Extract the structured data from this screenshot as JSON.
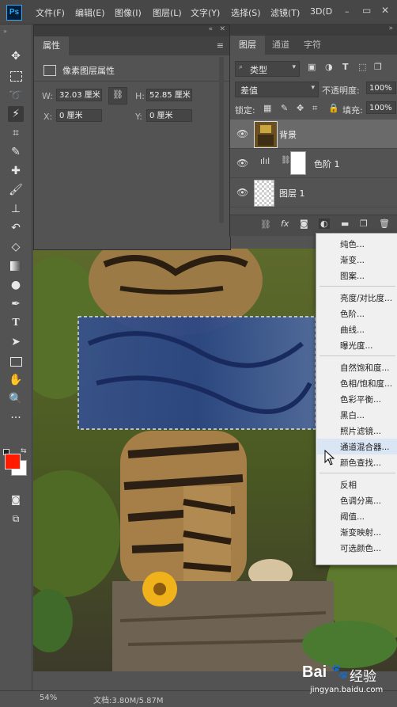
{
  "app": {
    "logo": "Ps"
  },
  "menubar": {
    "items": [
      "文件(F)",
      "编辑(E)",
      "图像(I)",
      "图层(L)",
      "文字(Y)",
      "选择(S)",
      "滤镜(T)",
      "3D(D"
    ]
  },
  "toolbar": {
    "icons": [
      "move-icon",
      "marquee-icon",
      "lasso-icon",
      "magic-wand-icon",
      "crop-icon",
      "eyedropper-icon",
      "healing-brush-icon",
      "brush-icon",
      "clone-stamp-icon",
      "history-brush-icon",
      "eraser-icon",
      "gradient-icon",
      "dodge-icon",
      "pen-icon",
      "type-icon",
      "path-selection-icon",
      "rectangle-icon",
      "hand-icon",
      "zoom-icon",
      "more-tools-icon"
    ],
    "foreground_color": "#ff1a00",
    "background_color": "#ffffff"
  },
  "properties": {
    "tab": "属性",
    "section_title": "像素图层属性",
    "w_label": "W:",
    "w_value": "32.03 厘米",
    "h_label": "H:",
    "h_value": "52.85 厘米",
    "x_label": "X:",
    "x_value": "0 厘米",
    "y_label": "Y:",
    "y_value": "0 厘米"
  },
  "layers": {
    "tabs": [
      "图层",
      "通道",
      "字符"
    ],
    "filter_kind": "类型",
    "blend_mode": "差值",
    "opacity_label": "不透明度:",
    "opacity_value": "100%",
    "lock_label": "锁定:",
    "fill_label": "填充:",
    "fill_value": "100%",
    "items": [
      {
        "name": "背景"
      },
      {
        "name": "色阶 1"
      },
      {
        "name": "图层 1"
      }
    ]
  },
  "adjustment_menu": {
    "groups": [
      [
        "纯色...",
        "渐变...",
        "图案..."
      ],
      [
        "亮度/对比度...",
        "色阶...",
        "曲线...",
        "曝光度..."
      ],
      [
        "自然饱和度...",
        "色相/饱和度...",
        "色彩平衡...",
        "黑白...",
        "照片滤镜...",
        "通道混合器...",
        "颜色查找..."
      ],
      [
        "反相",
        "色调分离...",
        "阈值...",
        "渐变映射...",
        "可选颜色..."
      ]
    ],
    "highlighted": "通道混合器..."
  },
  "status": {
    "zoom": "54%",
    "doc": "文档:3.80M/5.87M"
  },
  "watermark": {
    "brand": "Bai",
    "brand2": "经验",
    "url": "jingyan.baidu.com"
  }
}
